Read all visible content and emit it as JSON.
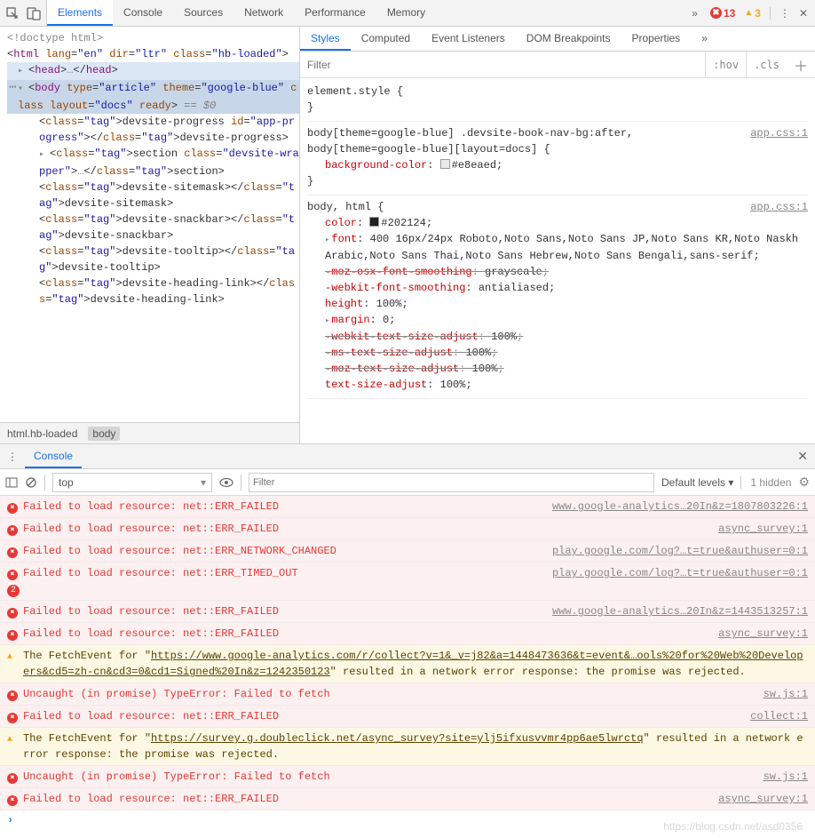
{
  "toolbar": {
    "tabs": [
      "Elements",
      "Console",
      "Sources",
      "Network",
      "Performance",
      "Memory"
    ],
    "more": "»",
    "errors": 13,
    "warnings": 3
  },
  "dom": {
    "doctype": "<!doctype html>",
    "html_open": {
      "tag": "html",
      "attrs": "lang=\"en\" dir=\"ltr\" class=\"hb-loaded\""
    },
    "head": {
      "open": "<head>",
      "ell": "…",
      "close": "</head>"
    },
    "body_open": {
      "tag": "body",
      "attrs": "type=\"article\" theme=\"google-blue\" class layout=\"docs\" ready",
      "dollar": " == $0"
    },
    "children": [
      "<devsite-progress id=\"app-progress\"></devsite-progress>",
      "<section class=\"devsite-wrapper\">…</section>",
      "<devsite-sitemask></devsite-sitemask>",
      "<devsite-snackbar></devsite-snackbar>",
      "<devsite-tooltip></devsite-tooltip>",
      "<devsite-heading-link></devsite-heading-link>"
    ],
    "crumbs": [
      "html.hb-loaded",
      "body"
    ]
  },
  "styles": {
    "tabs": [
      "Styles",
      "Computed",
      "Event Listeners",
      "DOM Breakpoints",
      "Properties"
    ],
    "more": "»",
    "filter_placeholder": "Filter",
    "hov": ":hov",
    "cls": ".cls",
    "rules": [
      {
        "selector": "element.style {",
        "close": "}",
        "src": "",
        "props": []
      },
      {
        "selector": "body[theme=google-blue] .devsite-book-nav-bg:after, body[theme=google-blue][layout=docs] {",
        "src": "app.css:1",
        "props": [
          {
            "name": "background-color",
            "value": "#e8eaed",
            "swatch": "#e8eaed"
          }
        ],
        "close": "}"
      },
      {
        "selector": "body, html {",
        "src": "app.css:1",
        "props": [
          {
            "name": "color",
            "value": "#202124",
            "swatch": "#202124"
          },
          {
            "name": "font",
            "value": "400 16px/24px Roboto,Noto Sans,Noto Sans JP,Noto Sans KR,Noto Naskh Arabic,Noto Sans Thai,Noto Sans Hebrew,Noto Sans Bengali,sans-serif",
            "tri": true
          },
          {
            "name": "-moz-osx-font-smoothing",
            "value": "grayscale",
            "strike": true
          },
          {
            "name": "-webkit-font-smoothing",
            "value": "antialiased"
          },
          {
            "name": "height",
            "value": "100%"
          },
          {
            "name": "margin",
            "value": "0",
            "tri": true
          },
          {
            "name": "-webkit-text-size-adjust",
            "value": "100%",
            "strike": true
          },
          {
            "name": "-ms-text-size-adjust",
            "value": "100%",
            "strike": true
          },
          {
            "name": "-moz-text-size-adjust",
            "value": "100%",
            "strike": true
          },
          {
            "name": "text-size-adjust",
            "value": "100%"
          }
        ],
        "close": ""
      }
    ]
  },
  "console": {
    "drawer_tab": "Console",
    "context": "top",
    "filter_placeholder": "Filter",
    "levels": "Default levels ▾",
    "hidden": "1 hidden",
    "messages": [
      {
        "type": "err",
        "text": "Failed to load resource: net::ERR_FAILED",
        "src": "www.google-analytics…20In&z=1807803226:1"
      },
      {
        "type": "err",
        "text": "Failed to load resource: net::ERR_FAILED",
        "src": "async_survey:1"
      },
      {
        "type": "err",
        "text": "Failed to load resource: net::ERR_NETWORK_CHANGED",
        "src": "play.google.com/log?…t=true&authuser=0:1"
      },
      {
        "type": "err",
        "count": 2,
        "text": "Failed to load resource: net::ERR_TIMED_OUT",
        "src": "play.google.com/log?…t=true&authuser=0:1"
      },
      {
        "type": "err",
        "text": "Failed to load resource: net::ERR_FAILED",
        "src": "www.google-analytics…20In&z=1443513257:1"
      },
      {
        "type": "err",
        "text": "Failed to load resource: net::ERR_FAILED",
        "src": "async_survey:1"
      },
      {
        "type": "warn",
        "pre": "The FetchEvent for \"",
        "link": "https://www.google-analytics.com/r/collect?v=1&_v=j82&a=1448473636&t=event&…ools%20for%20Web%20Developers&cd5=zh-cn&cd3=0&cd1=Signed%20In&z=1242350123",
        "post": "\" resulted in a network error response: the promise was rejected."
      },
      {
        "type": "err",
        "text": "Uncaught (in promise) TypeError: Failed to fetch",
        "src": "sw.js:1"
      },
      {
        "type": "err",
        "text": "Failed to load resource: net::ERR_FAILED",
        "src": "collect:1"
      },
      {
        "type": "warn",
        "pre": "The FetchEvent for \"",
        "link": "https://survey.g.doubleclick.net/async_survey?site=ylj5ifxusvvmr4pp6ae5lwrctq",
        "post": "\" resulted in a network error response: the promise was rejected."
      },
      {
        "type": "err",
        "text": "Uncaught (in promise) TypeError: Failed to fetch",
        "src": "sw.js:1"
      },
      {
        "type": "err",
        "text": "Failed to load resource: net::ERR_FAILED",
        "src": "async_survey:1"
      }
    ]
  },
  "watermark": "https://blog.csdn.net/asd0356"
}
